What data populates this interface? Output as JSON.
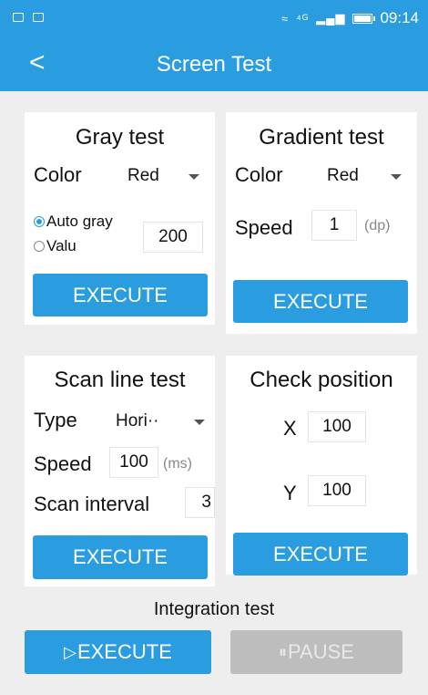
{
  "status": {
    "network": "⁴ᴳ",
    "time": "09:14"
  },
  "appbar": {
    "back": "<",
    "title": "Screen Test"
  },
  "gray": {
    "title": "Gray test",
    "color_label": "Color",
    "color_value": "Red",
    "auto_label": "Auto gray",
    "value_label": "Valu",
    "value": "200",
    "execute": "EXECUTE"
  },
  "gradient": {
    "title": "Gradient test",
    "color_label": "Color",
    "color_value": "Red",
    "speed_label": "Speed",
    "speed_value": "1",
    "speed_unit": "(dp)",
    "execute": "EXECUTE"
  },
  "scan": {
    "title": "Scan line test",
    "type_label": "Type",
    "type_value": "Hori··",
    "speed_label": "Speed",
    "speed_value": "100",
    "speed_unit": "(ms)",
    "interval_label": "Scan interval",
    "interval_value": "3",
    "execute": "EXECUTE"
  },
  "check": {
    "title": "Check position",
    "x_label": "X",
    "x_value": "100",
    "y_label": "Y",
    "y_value": "100",
    "execute": "EXECUTE"
  },
  "integration": {
    "title": "Integration test",
    "execute": "EXECUTE",
    "pause": "PAUSE"
  }
}
